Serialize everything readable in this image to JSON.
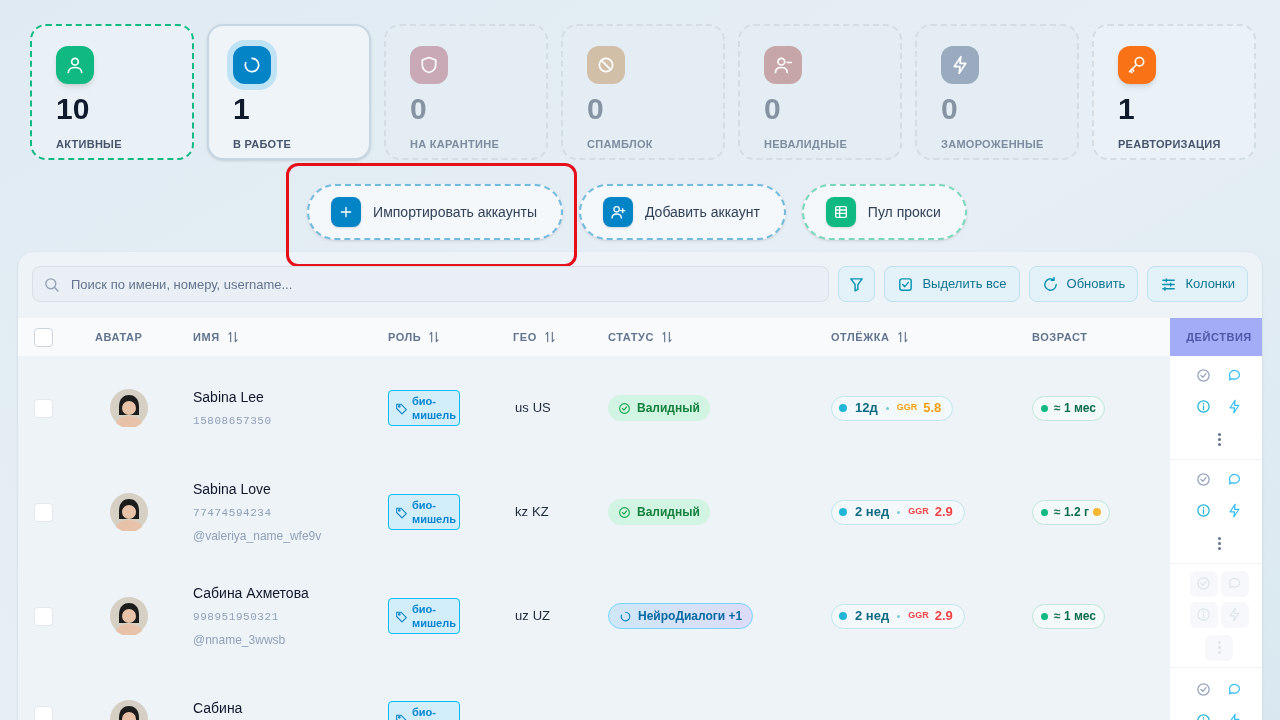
{
  "stats": [
    {
      "color": "#10b981",
      "count": "10",
      "label": "АКТИВНЫЕ",
      "selected": false,
      "muted": false,
      "highlighted": true
    },
    {
      "color": "#0284c7",
      "count": "1",
      "label": "В РАБОТЕ",
      "selected": true,
      "muted": false,
      "highlighted": false
    },
    {
      "color": "#c9a9b6",
      "count": "0",
      "label": "НА КАРАНТИНЕ",
      "selected": false,
      "muted": true,
      "highlighted": false
    },
    {
      "color": "#d2bfa8",
      "count": "0",
      "label": "СПАМБЛОК",
      "selected": false,
      "muted": true,
      "highlighted": false
    },
    {
      "color": "#c7a6a9",
      "count": "0",
      "label": "НЕВАЛИДНЫЕ",
      "selected": false,
      "muted": true,
      "highlighted": false
    },
    {
      "color": "#9aabc0",
      "count": "0",
      "label": "ЗАМОРОЖЕННЫЕ",
      "selected": false,
      "muted": true,
      "highlighted": false
    },
    {
      "color": "#f97316",
      "count": "1",
      "label": "РЕАВТОРИЗАЦИЯ",
      "selected": false,
      "muted": false,
      "highlighted": false
    }
  ],
  "actions": [
    {
      "color": "#0284c7",
      "label": "Импортировать аккаунты",
      "highlighted": true
    },
    {
      "color": "#0284c7",
      "label": "Добавить аккаунт",
      "highlighted": false
    },
    {
      "color": "#10b981",
      "label": "Пул прокси",
      "highlighted": false
    }
  ],
  "search": {
    "placeholder": "Поиск по имени, номеру, username..."
  },
  "tools": [
    "Выделить все",
    "Обновить",
    "Колонки"
  ],
  "select_all": {
    "checked": false
  },
  "columns": [
    {
      "label": "АВАТАР",
      "sortable": false
    },
    {
      "label": "ИМЯ",
      "sortable": true
    },
    {
      "label": "РОЛЬ",
      "sortable": true
    },
    {
      "label": "ГЕО",
      "sortable": true
    },
    {
      "label": "СТАТУС",
      "sortable": true
    },
    {
      "label": "ОТЛЁЖКА",
      "sortable": true
    },
    {
      "label": "ВОЗРАСТ",
      "sortable": false
    }
  ],
  "actions_label": "ДЕЙСТВИЯ",
  "rows": [
    {
      "checked": false,
      "name": "Sabina Lee",
      "phone": "15808657350",
      "role": "био-мишель",
      "geo_code": "us",
      "geo": "US",
      "status": {
        "kind": "valid",
        "label": "Валидный"
      },
      "rest": "12д",
      "ggr": {
        "label": "GGR",
        "value": "5.8",
        "color": "#f59e0b"
      },
      "age": "≈ 1 мес",
      "age_warning": false,
      "actions_disabled": false
    },
    {
      "checked": false,
      "name": "Sabina Love",
      "phone": "77474594234",
      "username": "@valeriya_name_wfe9v",
      "role": "био-мишель",
      "geo_code": "kz",
      "geo": "KZ",
      "status": {
        "kind": "valid",
        "label": "Валидный"
      },
      "rest": "2 нед",
      "ggr": {
        "label": "GGR",
        "value": "2.9",
        "color": "#ef4444"
      },
      "age": "≈ 1.2 г",
      "age_warning": true,
      "actions_disabled": false
    },
    {
      "checked": false,
      "name": "Сабина Ахметова",
      "phone": "998951950321",
      "username": "@nname_3wwsb",
      "role": "био-мишель",
      "geo_code": "uz",
      "geo": "UZ",
      "status": {
        "kind": "working",
        "label": "НейроДиалоги +1"
      },
      "rest": "2 нед",
      "ggr": {
        "label": "GGR",
        "value": "2.9",
        "color": "#ef4444"
      },
      "age": "≈ 1 мес",
      "age_warning": false,
      "actions_disabled": true
    },
    {
      "checked": false,
      "name": "Сабина",
      "role": "био-",
      "actions_disabled": false
    }
  ]
}
